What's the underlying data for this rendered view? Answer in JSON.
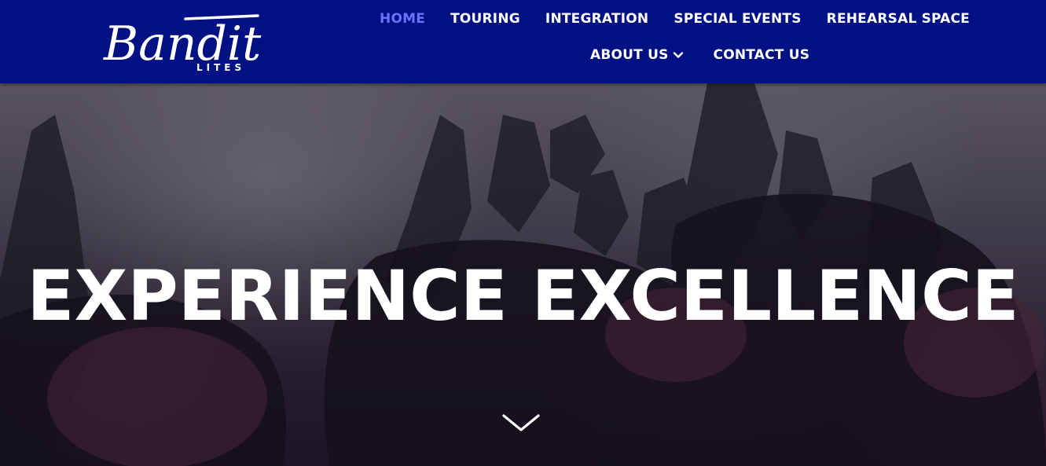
{
  "brand": {
    "logo_text": "Bandit",
    "logo_sub": "LITES"
  },
  "nav": {
    "row1": [
      {
        "label": "HOME",
        "active": true
      },
      {
        "label": "TOURING"
      },
      {
        "label": "INTEGRATION"
      },
      {
        "label": "SPECIAL EVENTS"
      },
      {
        "label": "REHEARSAL SPACE"
      }
    ],
    "row2": [
      {
        "label": "ABOUT US",
        "icon": "chevron-down-icon"
      },
      {
        "label": "CONTACT US"
      }
    ]
  },
  "hero": {
    "title": "EXPERIENCE EXCELLENCE",
    "scroll_icon": "chevron-down-icon"
  },
  "colors": {
    "header_bg": "#001183",
    "active_link": "#6a73ff",
    "text": "#ffffff"
  }
}
